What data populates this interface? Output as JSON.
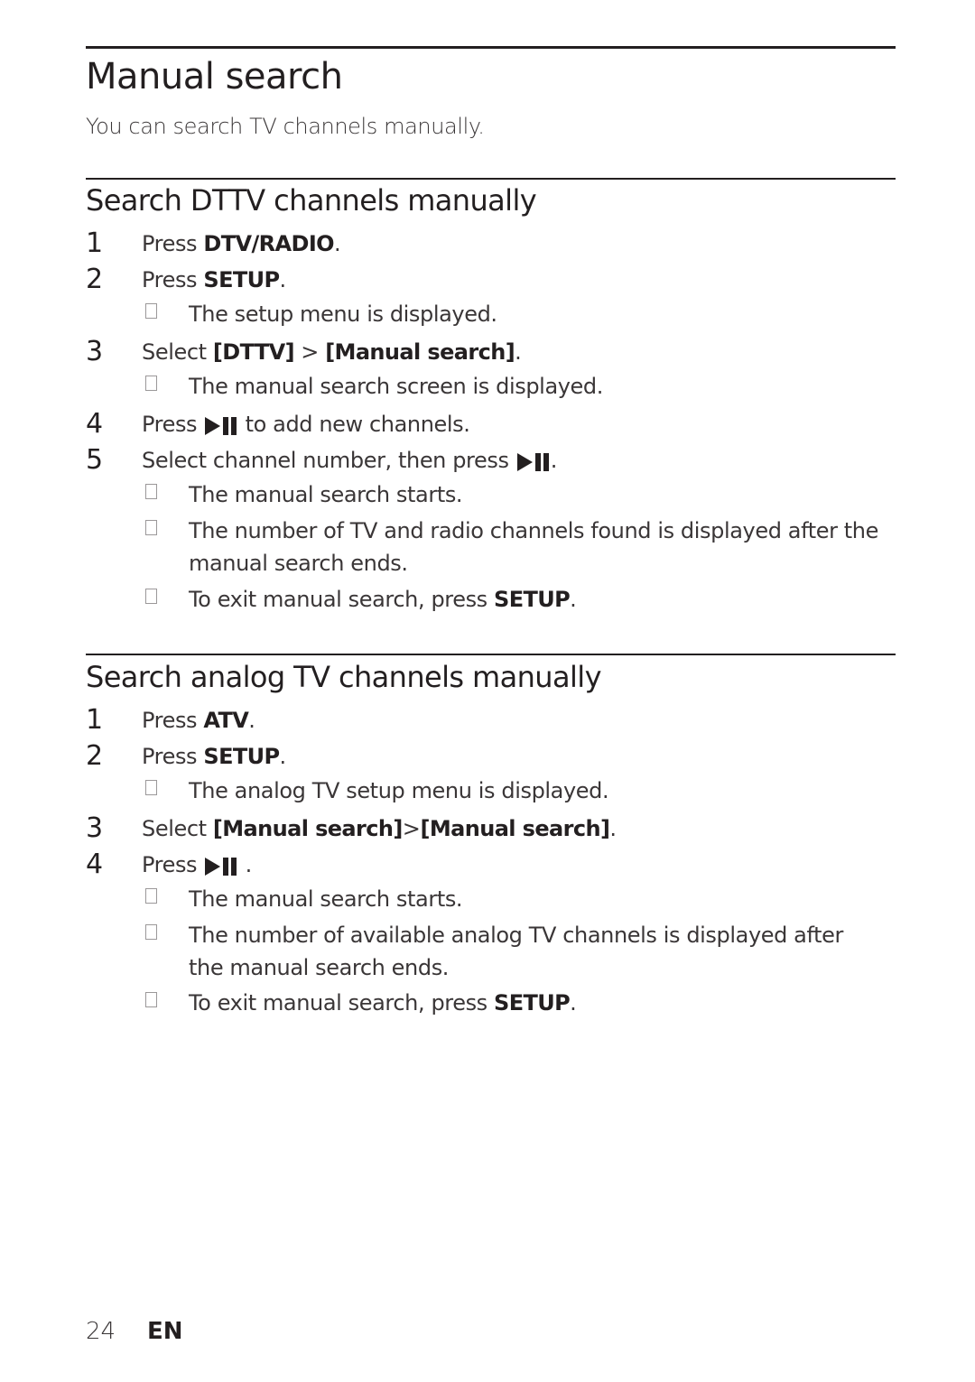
{
  "page": {
    "title": "Manual search",
    "intro": "You can search TV channels manually.",
    "sections": [
      {
        "heading": "Search DTTV channels manually",
        "steps": [
          {
            "num": "1",
            "pre": "Press ",
            "key": "DTV/RADIO",
            "post": "."
          },
          {
            "num": "2",
            "pre": "Press ",
            "key": "SETUP",
            "post": ".",
            "results": [
              "The setup menu is displayed."
            ]
          },
          {
            "num": "3",
            "pre": "Select ",
            "key": "[DTTV]",
            "mid": " > ",
            "key2": "[Manual search]",
            "post": ".",
            "results": [
              "The manual search screen is displayed."
            ]
          },
          {
            "num": "4",
            "pre": "Press ",
            "icon": "play-pause-icon",
            "post": " to add new channels."
          },
          {
            "num": "5",
            "pre": "Select channel number, then press ",
            "icon": "play-pause-icon",
            "post": ".",
            "results": [
              "The manual search starts.",
              "The number of TV and radio channels found is displayed after the manual search ends."
            ],
            "exit": {
              "pre": "To exit manual search, press ",
              "key": "SETUP",
              "post": "."
            }
          }
        ]
      },
      {
        "heading": "Search analog TV channels manually",
        "steps": [
          {
            "num": "1",
            "pre": "Press ",
            "key": "ATV",
            "post": "."
          },
          {
            "num": "2",
            "pre": "Press ",
            "key": "SETUP",
            "post": ".",
            "results": [
              "The analog TV setup menu is displayed."
            ]
          },
          {
            "num": "3",
            "pre": "Select ",
            "key": "[Manual search]",
            "mid": ">",
            "key2": "[Manual search]",
            "post": "."
          },
          {
            "num": "4",
            "pre": "Press ",
            "icon": "play-pause-icon",
            "post": " .",
            "results": [
              "The manual search starts.",
              "The number of available analog TV channels is displayed after the manual search ends."
            ],
            "exit": {
              "pre": "To exit manual search, press ",
              "key": "SETUP",
              "post": "."
            }
          }
        ]
      }
    ]
  },
  "footer": {
    "page_number": "24",
    "language": "EN"
  }
}
